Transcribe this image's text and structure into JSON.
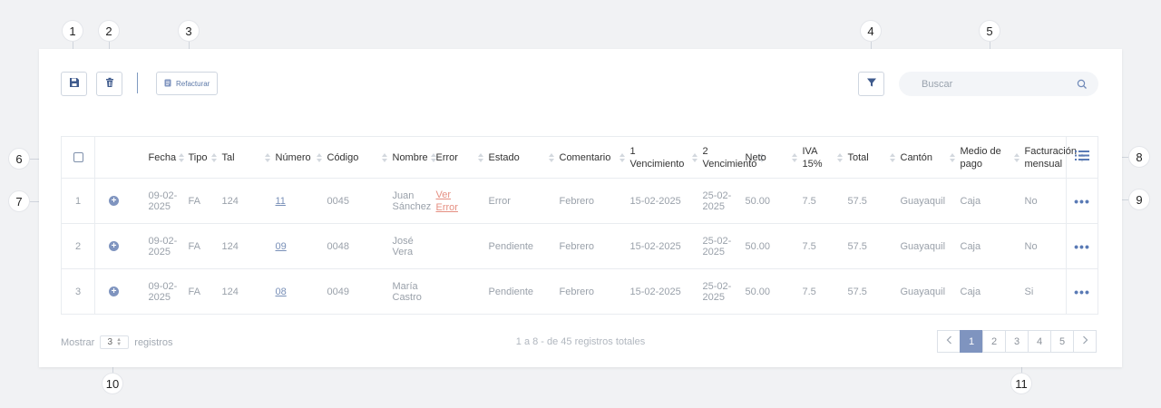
{
  "callouts": [
    "1",
    "2",
    "3",
    "4",
    "5",
    "6",
    "7",
    "8",
    "9",
    "10",
    "11"
  ],
  "toolbar": {
    "refacturar_label": "Refacturar",
    "search_placeholder": "Buscar"
  },
  "table": {
    "headers": {
      "fecha": "Fecha",
      "tipo": "Tipo",
      "tal": "Tal",
      "numero": "Número",
      "codigo": "Código",
      "nombre": "Nombre",
      "error": "Error",
      "estado": "Estado",
      "comentario": "Comentario",
      "venc1_a": "1",
      "venc1_b": "Vencimiento",
      "venc2_a": "2",
      "venc2_b": "Vencimiento",
      "neto": "Neto",
      "iva": "IVA 15%",
      "total": "Total",
      "canton": "Cantón",
      "medio_a": "Medio de",
      "medio_b": "pago",
      "fact_a": "Facturación",
      "fact_b": "mensual"
    },
    "rows": [
      {
        "index": "1",
        "fecha": "09-02-2025",
        "tipo": "FA",
        "tal": "124",
        "numero": "11",
        "codigo": "0045",
        "nombre": "Juan Sánchez",
        "error_a": "Ver",
        "error_b": "Error",
        "estado": "Error",
        "comentario": "Febrero",
        "venc1": "15-02-2025",
        "venc2": "25-02-2025",
        "neto": "50.00",
        "iva": "7.5",
        "total": "57.5",
        "canton": "Guayaquil",
        "medio": "Caja",
        "fact": "No"
      },
      {
        "index": "2",
        "fecha": "09-02-2025",
        "tipo": "FA",
        "tal": "124",
        "numero": "09",
        "codigo": "0048",
        "nombre": "José Vera",
        "error_a": "",
        "error_b": "",
        "estado": "Pendiente",
        "comentario": "Febrero",
        "venc1": "15-02-2025",
        "venc2": "25-02-2025",
        "neto": "50.00",
        "iva": "7.5",
        "total": "57.5",
        "canton": "Guayaquil",
        "medio": "Caja",
        "fact": "No"
      },
      {
        "index": "3",
        "fecha": "09-02-2025",
        "tipo": "FA",
        "tal": "124",
        "numero": "08",
        "codigo": "0049",
        "nombre": "María Castro",
        "error_a": "",
        "error_b": "",
        "estado": "Pendiente",
        "comentario": "Febrero",
        "venc1": "15-02-2025",
        "venc2": "25-02-2025",
        "neto": "50.00",
        "iva": "7.5",
        "total": "57.5",
        "canton": "Guayaquil",
        "medio": "Caja",
        "fact": "Si"
      }
    ]
  },
  "footer": {
    "show_label": "Mostrar",
    "page_size": "3",
    "records_label": "registros",
    "summary": "1 a 8 - de 45 registros totales",
    "pages": [
      "1",
      "2",
      "3",
      "4",
      "5"
    ],
    "active_page": "1"
  },
  "colors": {
    "accent": "#7f94bf",
    "error_link": "#e58f82",
    "link": "#7990b8"
  },
  "icons": [
    "save-icon",
    "trash-icon",
    "document-icon",
    "filter-icon",
    "search-icon",
    "list-icon",
    "plus-circle-icon",
    "more-dots-icon",
    "chevron-left-icon",
    "chevron-right-icon"
  ]
}
